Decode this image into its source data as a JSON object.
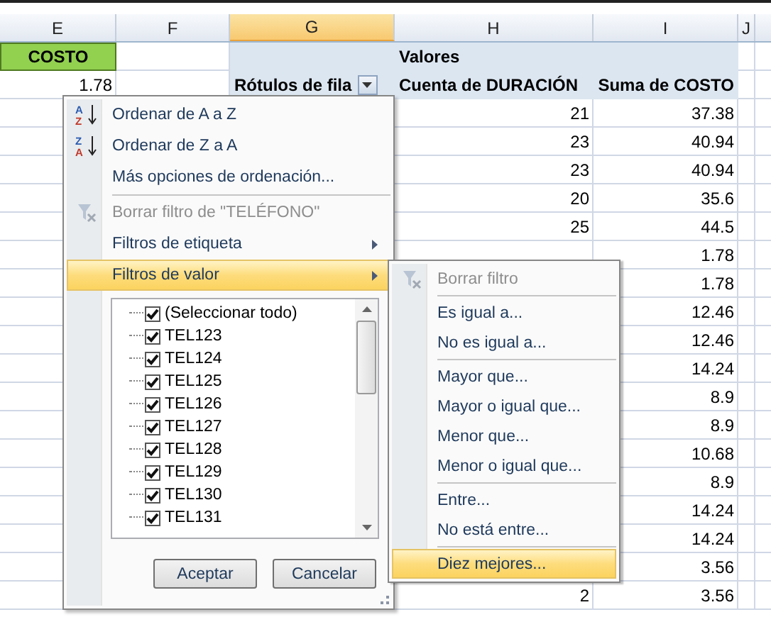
{
  "columns": [
    {
      "label": "E",
      "selected": false
    },
    {
      "label": "F",
      "selected": false
    },
    {
      "label": "G",
      "selected": true
    },
    {
      "label": "H",
      "selected": false
    },
    {
      "label": "I",
      "selected": false
    },
    {
      "label": "J",
      "selected": false
    }
  ],
  "field_header": "COSTO",
  "first_value": "1.78",
  "pivot": {
    "title": "Valores",
    "row_labels": "Rótulos de fila",
    "column_1": "Cuenta de DURACIÓN",
    "column_2": "Suma de COSTO",
    "rows": [
      {
        "count": "21",
        "sum": "37.38"
      },
      {
        "count": "23",
        "sum": "40.94"
      },
      {
        "count": "23",
        "sum": "40.94"
      },
      {
        "count": "20",
        "sum": "35.6"
      },
      {
        "count": "25",
        "sum": "44.5"
      },
      {
        "sum": "1.78"
      },
      {
        "sum": "1.78"
      },
      {
        "sum": "12.46"
      },
      {
        "sum": "12.46"
      },
      {
        "sum": "14.24"
      },
      {
        "sum": "8.9"
      },
      {
        "sum": "8.9"
      },
      {
        "sum": "10.68"
      },
      {
        "sum": "8.9"
      },
      {
        "sum": "14.24"
      },
      {
        "sum": "14.24"
      },
      {
        "sum": "3.56"
      },
      {
        "count": "2",
        "sum": "3.56"
      }
    ]
  },
  "menu": {
    "items": [
      {
        "kind": "sort",
        "icon_letters": [
          "A",
          "Z"
        ],
        "label": "Ordenar de A a Z",
        "disabled": false,
        "highlighted": false
      },
      {
        "kind": "sort",
        "icon_letters": [
          "Z",
          "A"
        ],
        "label": "Ordenar de Z a A",
        "disabled": false,
        "highlighted": false
      },
      {
        "kind": "command",
        "label": "Más opciones de ordenación...",
        "disabled": false,
        "highlighted": false
      },
      {
        "kind": "separator"
      },
      {
        "kind": "clear_filter",
        "label": "Borrar filtro de \"TELÉFONO\"",
        "disabled": true,
        "highlighted": false
      },
      {
        "kind": "submenu",
        "label": "Filtros de etiqueta",
        "disabled": false,
        "highlighted": false
      },
      {
        "kind": "submenu",
        "label": "Filtros de valor",
        "disabled": false,
        "highlighted": true
      }
    ],
    "list": [
      {
        "label": "(Seleccionar todo)",
        "checked": true
      },
      {
        "label": "TEL123",
        "checked": true
      },
      {
        "label": "TEL124",
        "checked": true
      },
      {
        "label": "TEL125",
        "checked": true
      },
      {
        "label": "TEL126",
        "checked": true
      },
      {
        "label": "TEL127",
        "checked": true
      },
      {
        "label": "TEL128",
        "checked": true
      },
      {
        "label": "TEL129",
        "checked": true
      },
      {
        "label": "TEL130",
        "checked": true
      },
      {
        "label": "TEL131",
        "checked": true
      }
    ],
    "buttons": [
      "Aceptar",
      "Cancelar"
    ]
  },
  "submenu": {
    "items": [
      {
        "kind": "clear_filter",
        "label": "Borrar filtro",
        "disabled": true,
        "highlighted": false
      },
      {
        "kind": "separator"
      },
      {
        "kind": "command",
        "label": "Es igual a...",
        "disabled": false,
        "highlighted": false
      },
      {
        "kind": "command",
        "label": "No es igual a...",
        "disabled": false,
        "highlighted": false
      },
      {
        "kind": "separator"
      },
      {
        "kind": "command",
        "label": "Mayor que...",
        "disabled": false,
        "highlighted": false
      },
      {
        "kind": "command",
        "label": "Mayor o igual que...",
        "disabled": false,
        "highlighted": false
      },
      {
        "kind": "command",
        "label": "Menor que...",
        "disabled": false,
        "highlighted": false
      },
      {
        "kind": "command",
        "label": "Menor o igual que...",
        "disabled": false,
        "highlighted": false
      },
      {
        "kind": "separator"
      },
      {
        "kind": "command",
        "label": "Entre...",
        "disabled": false,
        "highlighted": false
      },
      {
        "kind": "command",
        "label": "No está entre...",
        "disabled": false,
        "highlighted": false
      },
      {
        "kind": "separator"
      },
      {
        "kind": "command",
        "label": "Diez mejores...",
        "disabled": false,
        "highlighted": true
      }
    ]
  }
}
